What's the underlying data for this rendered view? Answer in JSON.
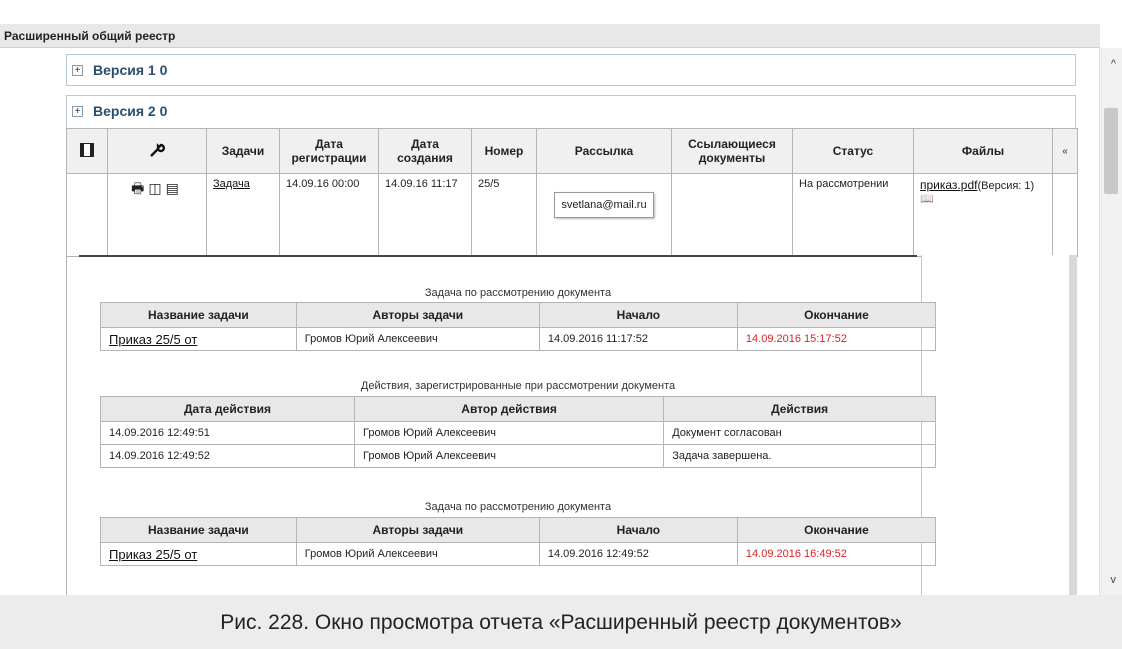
{
  "panel": {
    "title": "Расширенный общий реестр"
  },
  "groups": [
    {
      "label": "Версия 1  0"
    },
    {
      "label": "Версия 2  0"
    }
  ],
  "grid": {
    "headers": {
      "tasks": "Задачи",
      "reg_date": "Дата регистрации",
      "created": "Дата создания",
      "number": "Номер",
      "mailing": "Рассылка",
      "refs": "Ссылающиеся документы",
      "status": "Статус",
      "files": "Файлы"
    },
    "row": {
      "task_link": "Задача",
      "reg_date": "14.09.16 00:00",
      "created": "14.09.16 11:17",
      "number": "25/5",
      "email": "svetlana@mail.ru",
      "refs": "",
      "status": "На рассмотрении",
      "file_link": "приказ.pdf",
      "file_version": "(Версия: 1)"
    }
  },
  "detail": {
    "section1": {
      "caption": "Задача по рассмотрению документа",
      "headers": [
        "Название задачи",
        "Авторы задачи",
        "Начало",
        "Окончание"
      ],
      "row": [
        "Приказ 25/5 от",
        "Громов Юрий Алексеевич",
        "14.09.2016 11:17:52",
        "14.09.2016 15:17:52"
      ]
    },
    "section2": {
      "caption": "Действия, зарегистрированные при рассмотрении документа",
      "headers": [
        "Дата действия",
        "Автор действия",
        "Действия"
      ],
      "rows": [
        [
          "14.09.2016 12:49:51",
          "Громов Юрий Алексеевич",
          "Документ согласован"
        ],
        [
          "14.09.2016 12:49:52",
          "Громов Юрий Алексеевич",
          "Задача завершена."
        ]
      ]
    },
    "section3": {
      "caption": "Задача по рассмотрению документа",
      "headers": [
        "Название задачи",
        "Авторы задачи",
        "Начало",
        "Окончание"
      ],
      "row": [
        "Приказ 25/5 от",
        "Громов Юрий Алексеевич",
        "14.09.2016 12:49:52",
        "14.09.2016 16:49:52"
      ]
    }
  },
  "figure_caption": "Рис. 228. Окно просмотра отчета «Расширенный реестр документов»",
  "icons": [
    "column-chooser-icon",
    "wrench-icon",
    "print-icon",
    "preview-icon",
    "report-preview-icon",
    "book-icon",
    "collapse-icon"
  ],
  "colors": {
    "accent": "#2a4f6e",
    "deadline_red": "#e02020"
  }
}
